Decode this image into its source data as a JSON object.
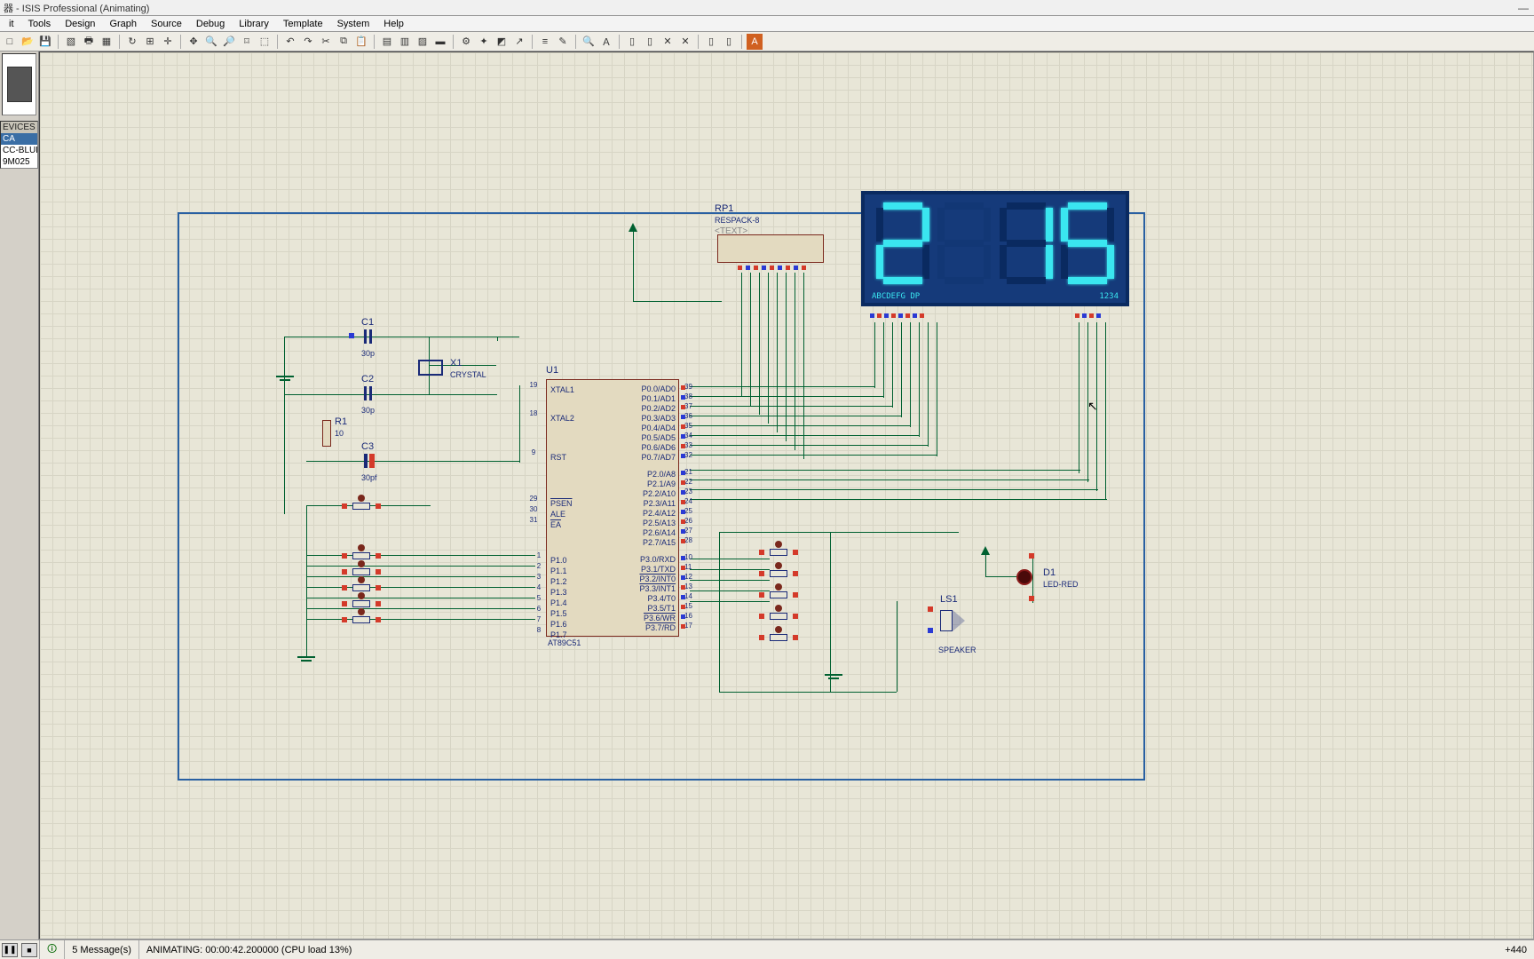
{
  "title": "器 - ISIS Professional (Animating)",
  "menus": [
    "it",
    "Tools",
    "Design",
    "Graph",
    "Source",
    "Debug",
    "Library",
    "Template",
    "System",
    "Help"
  ],
  "devices": {
    "header": "EVICES",
    "items": [
      "CA",
      "CC-BLUE",
      "9M025"
    ],
    "selected_index": 0
  },
  "status": {
    "messages": "5 Message(s)",
    "anim": "ANIMATING: 00:00:42.200000 (CPU load 13%)",
    "coord": "+440"
  },
  "components": {
    "rp1_ref": "RP1",
    "rp1_val": "RESPACK-8",
    "rp1_text": "<TEXT>",
    "c1_ref": "C1",
    "c1_val": "30p",
    "c2_ref": "C2",
    "c2_val": "30p",
    "c3_ref": "C3",
    "c3_val": "30pf",
    "r1_ref": "R1",
    "r1_val": "10",
    "x1_ref": "X1",
    "x1_val": "CRYSTAL",
    "u1_ref": "U1",
    "u1_val": "AT89C51",
    "ls1_ref": "LS1",
    "ls1_val": "SPEAKER",
    "d1_ref": "D1",
    "d1_val": "LED-RED"
  },
  "mcu_pins_left": [
    {
      "num": "19",
      "name": "XTAL1"
    },
    {
      "num": "18",
      "name": "XTAL2"
    },
    {
      "num": "9",
      "name": "RST"
    },
    {
      "num": "29",
      "name": "PSEN",
      "over": true
    },
    {
      "num": "30",
      "name": "ALE"
    },
    {
      "num": "31",
      "name": "EA",
      "over": true
    },
    {
      "num": "1",
      "name": "P1.0"
    },
    {
      "num": "2",
      "name": "P1.1"
    },
    {
      "num": "3",
      "name": "P1.2"
    },
    {
      "num": "4",
      "name": "P1.3"
    },
    {
      "num": "5",
      "name": "P1.4"
    },
    {
      "num": "6",
      "name": "P1.5"
    },
    {
      "num": "7",
      "name": "P1.6"
    },
    {
      "num": "8",
      "name": "P1.7"
    }
  ],
  "mcu_pins_right": [
    {
      "num": "39",
      "name": "P0.0/AD0"
    },
    {
      "num": "38",
      "name": "P0.1/AD1"
    },
    {
      "num": "37",
      "name": "P0.2/AD2"
    },
    {
      "num": "36",
      "name": "P0.3/AD3"
    },
    {
      "num": "35",
      "name": "P0.4/AD4"
    },
    {
      "num": "34",
      "name": "P0.5/AD5"
    },
    {
      "num": "33",
      "name": "P0.6/AD6"
    },
    {
      "num": "32",
      "name": "P0.7/AD7"
    },
    {
      "num": "21",
      "name": "P2.0/A8"
    },
    {
      "num": "22",
      "name": "P2.1/A9"
    },
    {
      "num": "23",
      "name": "P2.2/A10"
    },
    {
      "num": "24",
      "name": "P2.3/A11"
    },
    {
      "num": "25",
      "name": "P2.4/A12"
    },
    {
      "num": "26",
      "name": "P2.5/A13"
    },
    {
      "num": "27",
      "name": "P2.6/A14"
    },
    {
      "num": "28",
      "name": "P2.7/A15"
    },
    {
      "num": "10",
      "name": "P3.0/RXD"
    },
    {
      "num": "11",
      "name": "P3.1/TXD"
    },
    {
      "num": "12",
      "name": "P3.2/INT0",
      "over": true
    },
    {
      "num": "13",
      "name": "P3.3/INT1",
      "over": true
    },
    {
      "num": "14",
      "name": "P3.4/T0"
    },
    {
      "num": "15",
      "name": "P3.5/T1"
    },
    {
      "num": "16",
      "name": "P3.6/WR",
      "over": true
    },
    {
      "num": "17",
      "name": "P3.7/RD",
      "over": true
    }
  ],
  "sevenseg": {
    "digits": [
      "2",
      "",
      "1",
      "5"
    ],
    "pin_label_left": "ABCDEFG  DP",
    "pin_label_right": "1234"
  },
  "toolbar_icons": [
    "new",
    "open",
    "save",
    "print",
    "sep",
    "region",
    "grid",
    "origin",
    "sep",
    "pan",
    "zin",
    "zout",
    "zall",
    "zarea",
    "sep",
    "undo",
    "redo",
    "cut",
    "copy",
    "paste",
    "sep",
    "block-copy",
    "block-move",
    "block-rot",
    "block-del",
    "sep",
    "pick",
    "find",
    "sep",
    "wire-auto",
    "wire-label",
    "sep",
    "gen",
    "sep",
    "t1",
    "t2",
    "t3",
    "t4",
    "sep",
    "report",
    "bom",
    "sep",
    "ares"
  ]
}
